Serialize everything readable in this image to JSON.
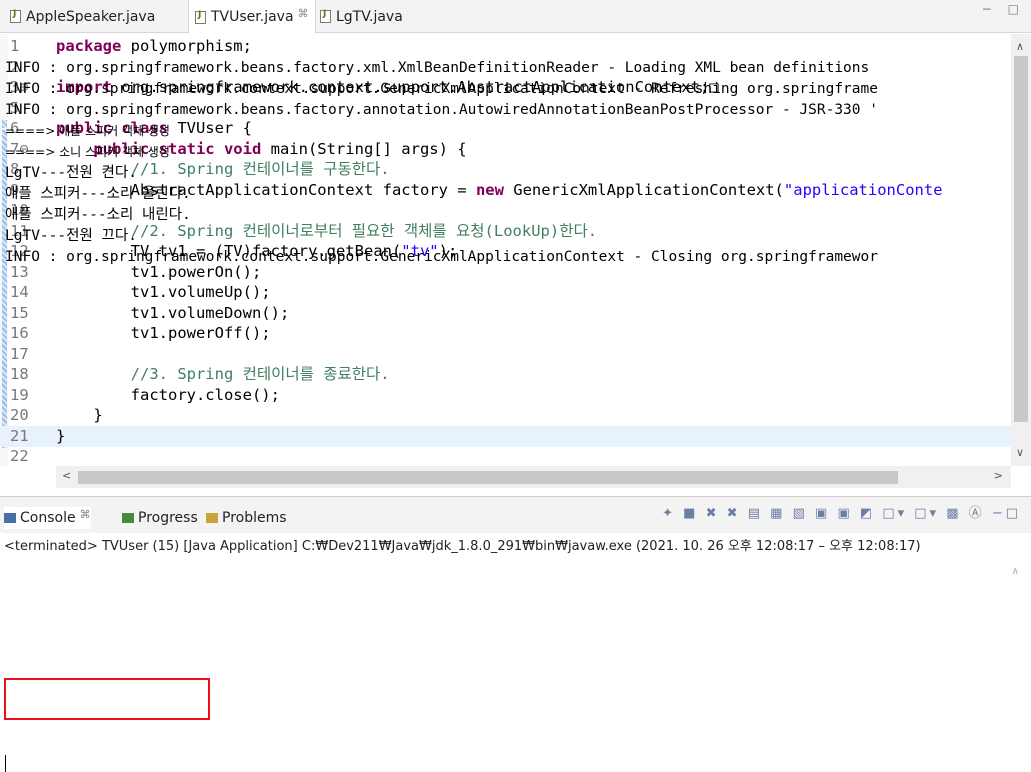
{
  "editor": {
    "tabs": [
      {
        "label": "AppleSpeaker.java",
        "active": false
      },
      {
        "label": "TVUser.java",
        "active": true,
        "close_mark": "⌘"
      },
      {
        "label": "LgTV.java",
        "active": false
      }
    ],
    "window_controls": "− □",
    "lines": [
      {
        "num": "1",
        "html": "<span class=\"kw\">package</span> polymorphism;"
      },
      {
        "num": "2",
        "html": ""
      },
      {
        "num": "3⊕",
        "html": "<span class=\"kw\">import</span> org.springframework.context.support.AbstractApplicationContext;□"
      },
      {
        "num": "5",
        "html": ""
      },
      {
        "num": "6",
        "html": "<span class=\"kw\">public class</span> TVUser {"
      },
      {
        "num": "7⊖",
        "html": "    <span class=\"kw\">public static void</span> main(String[] args) {"
      },
      {
        "num": "8",
        "html": "        <span class=\"cm\">//1. Spring 컨테이너를 구동한다.</span>"
      },
      {
        "num": "9",
        "html": "        AbstractApplicationContext factory = <span class=\"kw\">new</span> GenericXmlApplicationContext(<span class=\"str\">\"applicationConte</span>"
      },
      {
        "num": "10",
        "html": ""
      },
      {
        "num": "11",
        "html": "        <span class=\"cm\">//2. Spring 컨테이너로부터 필요한 객체를 요청(LookUp)한다.</span>"
      },
      {
        "num": "12",
        "html": "        TV tv1 = (TV)factory.getBean(<span class=\"str\">\"tv\"</span>);"
      },
      {
        "num": "13",
        "html": "        tv1.powerOn();"
      },
      {
        "num": "14",
        "html": "        tv1.volumeUp();"
      },
      {
        "num": "15",
        "html": "        tv1.volumeDown();"
      },
      {
        "num": "16",
        "html": "        tv1.powerOff();"
      },
      {
        "num": "17",
        "html": ""
      },
      {
        "num": "18",
        "html": "        <span class=\"cm\">//3. Spring 컨테이너를 종료한다.</span>"
      },
      {
        "num": "19",
        "html": "        factory.close();"
      },
      {
        "num": "20",
        "html": "    }"
      },
      {
        "num": "21",
        "html": "}"
      },
      {
        "num": "22",
        "html": ""
      }
    ]
  },
  "console": {
    "tabs": [
      {
        "label": "Console",
        "close_mark": "⌘"
      },
      {
        "label": "Progress"
      },
      {
        "label": "Problems"
      }
    ],
    "terminated": "<terminated> TVUser (15) [Java Application] C:₩Dev211₩Java₩jdk_1.8.0_291₩bin₩javaw.exe  (2021. 10. 26 오후 12:08:17 – 오후 12:08:17)",
    "lines": [
      {
        "text": "INFO : org.springframework.beans.factory.xml.XmlBeanDefinitionReader - Loading XML bean definitions",
        "small": false
      },
      {
        "text": "INFO : org.springframework.context.support.GenericXmlApplicationContext - Refreshing org.springframe",
        "small": false
      },
      {
        "text": "INFO : org.springframework.beans.factory.annotation.AutowiredAnnotationBeanPostProcessor - JSR-330 '",
        "small": false
      },
      {
        "text": "====> 애플 스피커 객체 생성",
        "small": true
      },
      {
        "text": "====> 소니 스피커 객체 생성",
        "small": true
      },
      {
        "text": "LgTV---전원 켠다.",
        "small": false
      },
      {
        "text": "애플 스피커---소리 울린다.",
        "small": false
      },
      {
        "text": "애플 스피커---소리 내린다.",
        "small": false
      },
      {
        "text": "LgTV---전원 끄다.",
        "small": false
      },
      {
        "text": "INFO : org.springframework.context.support.GenericXmlApplicationContext - Closing org.springframewor",
        "small": false
      }
    ]
  },
  "colors": {
    "keyword": "#7f0055",
    "comment": "#3f7f5f",
    "string": "#2a00ff",
    "highlight_box": "#e8101a"
  }
}
